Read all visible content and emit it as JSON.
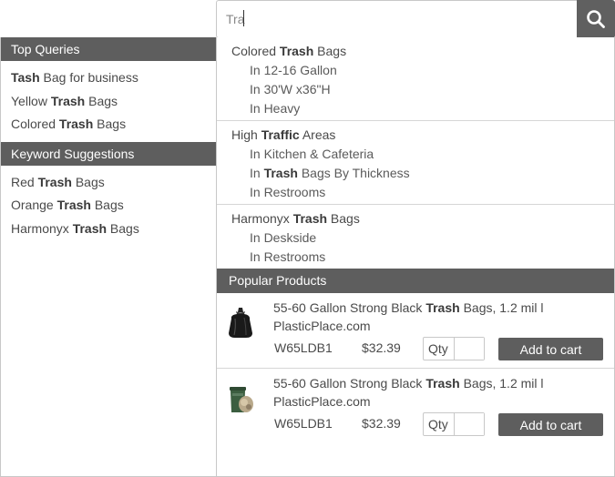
{
  "search": {
    "value": "Tra",
    "icon": "search-icon"
  },
  "left": {
    "top_queries_header": "Top Queries",
    "top_queries": [
      {
        "bold": "Tash",
        "rest": " Bag for business",
        "pre": ""
      },
      {
        "pre": "Yellow ",
        "bold": "Trash",
        "rest": " Bags"
      },
      {
        "pre": "Colored ",
        "bold": "Trash",
        "rest": " Bags"
      }
    ],
    "keyword_header": "Keyword Suggestions",
    "keywords": [
      {
        "pre": "Red ",
        "bold": "Trash",
        "rest": " Bags"
      },
      {
        "pre": "Orange ",
        "bold": "Trash",
        "rest": " Bags"
      },
      {
        "pre": "Harmonyx ",
        "bold": "Trash",
        "rest": " Bags"
      }
    ]
  },
  "groups": [
    {
      "title_pre": "Colored ",
      "title_bold": "Trash",
      "title_rest": " Bags",
      "subs": [
        {
          "pre": "In 12-16 Gallon",
          "bold": "",
          "rest": ""
        },
        {
          "pre": "In 30'W x36\"H",
          "bold": "",
          "rest": ""
        },
        {
          "pre": "In Heavy",
          "bold": "",
          "rest": ""
        }
      ]
    },
    {
      "title_pre": "High ",
      "title_bold": "Traffic",
      "title_rest": " Areas",
      "subs": [
        {
          "pre": "In Kitchen & Cafeteria",
          "bold": "",
          "rest": ""
        },
        {
          "pre": "In ",
          "bold": "Trash",
          "rest": " Bags By Thickness"
        },
        {
          "pre": "In Restrooms",
          "bold": "",
          "rest": ""
        }
      ]
    },
    {
      "title_pre": "Harmonyx ",
      "title_bold": "Trash",
      "title_rest": " Bags",
      "subs": [
        {
          "pre": "In Deskside",
          "bold": "",
          "rest": ""
        },
        {
          "pre": "In Restrooms",
          "bold": "",
          "rest": ""
        }
      ]
    }
  ],
  "popular": {
    "header": "Popular Products",
    "products": [
      {
        "name_pre": "55-60 Gallon Strong Black ",
        "name_bold": "Trash",
        "name_rest": " Bags, 1.2 mil l PlasticPlace.com",
        "sku": "W65LDB1",
        "price": "$32.39",
        "qty_label": "Qty",
        "qty_value": "",
        "button": "Add to cart",
        "image": "black-trash-bag"
      },
      {
        "name_pre": "55-60 Gallon Strong Black ",
        "name_bold": "Trash",
        "name_rest": " Bags, 1.2 mil l PlasticPlace.com",
        "sku": "W65LDB1",
        "price": "$32.39",
        "qty_label": "Qty",
        "qty_value": "",
        "button": "Add to cart",
        "image": "trash-can-with-bags"
      }
    ]
  },
  "colors": {
    "header_bg": "#5e5e5e",
    "button_bg": "#606060",
    "border": "#c8c8c8"
  }
}
